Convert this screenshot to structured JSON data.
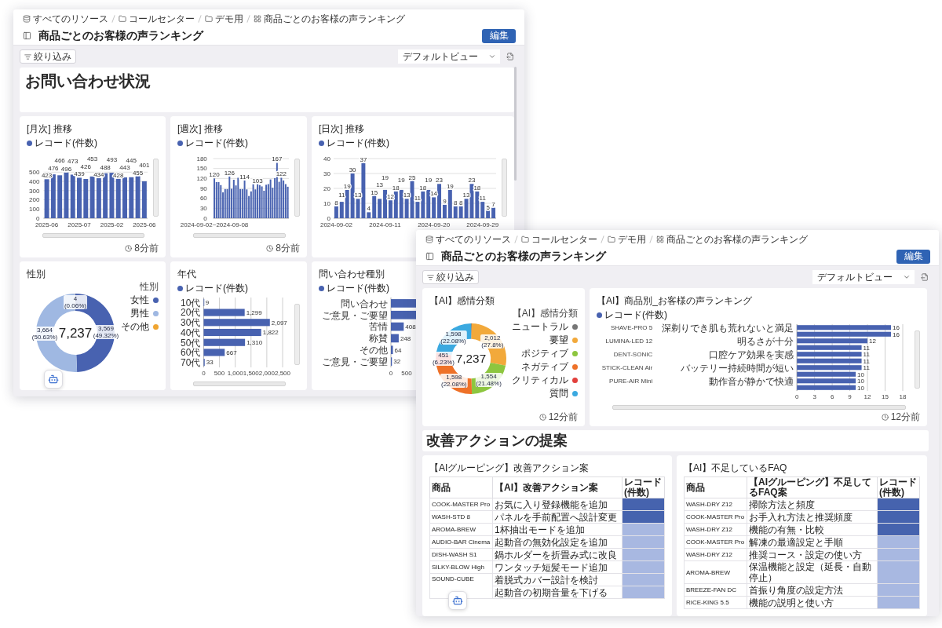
{
  "windows": [
    {
      "breadcrumb": [
        {
          "kind": "database",
          "label": "すべてのリソース"
        },
        {
          "kind": "folder",
          "label": "コールセンター"
        },
        {
          "kind": "folder",
          "label": "デモ用"
        },
        {
          "kind": "dashboard",
          "label": "商品ごとのお客様の声ランキング"
        }
      ],
      "title": "商品ごとのお客様の声ランキング",
      "edit_button": "編集",
      "filter_button": "絞り込み",
      "view_select": "デフォルトビュー",
      "scrollbar": true,
      "blocks": [
        {
          "kind": "heading",
          "text": "お問い合わせ状況"
        },
        {
          "kind": "cards",
          "cards": [
            {
              "kind": "chart",
              "title": "[月次] 推移",
              "vertical_scrollbar": true,
              "horizontal_scrollbar": true,
              "updated": "8分前",
              "chart_data": {
                "type": "bar",
                "categories": [
                  "2025-06",
                  null,
                  null,
                  null,
                  null,
                  "2025-07",
                  null,
                  null,
                  null,
                  null,
                  "2025-02",
                  null,
                  null,
                  null,
                  null,
                  "2025-06"
                ],
                "series": [
                  {
                    "name": "レコード(件数)",
                    "color": "#4862b0",
                    "values": [
                      423,
                      476,
                      466,
                      496,
                      473,
                      439,
                      426,
                      453,
                      434,
                      488,
                      493,
                      428,
                      443,
                      445,
                      455,
                      401
                    ]
                  }
                ],
                "ylim": [
                  0,
                  500
                ],
                "yticks": [
                  0,
                  100,
                  200,
                  300,
                  400,
                  500
                ],
                "grid": true,
                "data_labels": true
              }
            },
            {
              "kind": "chart",
              "title": "[週次] 推移",
              "vertical_scrollbar": true,
              "horizontal_scrollbar": true,
              "updated": "8分前",
              "chart_data": {
                "type": "bar",
                "categories": [
                  "2024-09-02~2024-09-08",
                  null,
                  null,
                  null,
                  null,
                  null,
                  null,
                  null,
                  null,
                  null,
                  null,
                  null,
                  null,
                  null,
                  null,
                  null,
                  null,
                  null,
                  null,
                  null,
                  null,
                  null,
                  null,
                  null,
                  null,
                  null,
                  null,
                  null,
                  null,
                  null,
                  null,
                  null,
                  null,
                  null,
                  null
                ],
                "series": [
                  {
                    "name": "レコード(件数)",
                    "color": "#4862b0",
                    "values": [
                      120,
                      109,
                      109,
                      100,
                      78,
                      88,
                      88,
                      126,
                      89,
                      116,
                      99,
                      122,
                      88,
                      88,
                      114,
                      87,
                      67,
                      81,
                      103,
                      87,
                      103,
                      100,
                      96,
                      83,
                      101,
                      103,
                      117,
                      92,
                      121,
                      167,
                      110,
                      122,
                      114,
                      103,
                      95
                    ]
                  }
                ],
                "value_labels": [
                  "120",
                  null,
                  null,
                  null,
                  null,
                  null,
                  null,
                  "126",
                  null,
                  null,
                  null,
                  null,
                  null,
                  null,
                  "114",
                  null,
                  null,
                  null,
                  null,
                  null,
                  "103",
                  null,
                  null,
                  null,
                  null,
                  null,
                  null,
                  null,
                  null,
                  "167",
                  null,
                  "122",
                  null,
                  null,
                  null
                ],
                "ylim": [
                  0,
                  180
                ],
                "yticks": [
                  0,
                  30,
                  60,
                  90,
                  120,
                  150,
                  180
                ],
                "grid": true
              }
            },
            {
              "kind": "chart",
              "title": "[日次] 推移",
              "vertical_scrollbar": true,
              "chart_data": {
                "type": "bar",
                "categories": [
                  "2024-09-02",
                  null,
                  null,
                  null,
                  null,
                  null,
                  null,
                  null,
                  null,
                  "2024-09-11",
                  null,
                  null,
                  null,
                  null,
                  null,
                  null,
                  null,
                  null,
                  "2024-09-20",
                  null,
                  null,
                  null,
                  null,
                  null,
                  null,
                  null,
                  null,
                  "2024-09-29",
                  null,
                  null
                ],
                "series": [
                  {
                    "name": "レコード(件数)",
                    "color": "#4862b0",
                    "values": [
                      8,
                      11,
                      19,
                      30,
                      13,
                      37,
                      4,
                      15,
                      13,
                      19,
                      12,
                      18,
                      19,
                      13,
                      25,
                      11,
                      18,
                      19,
                      14,
                      23,
                      9,
                      19,
                      8,
                      8,
                      13,
                      23,
                      18,
                      11,
                      5,
                      7
                    ]
                  }
                ],
                "ylim": [
                  0,
                  40
                ],
                "yticks": [
                  0,
                  10,
                  20,
                  30,
                  40
                ],
                "grid": true,
                "data_labels": true
              }
            }
          ]
        },
        {
          "kind": "cards",
          "cards": [
            {
              "kind": "chart",
              "title": "性別",
              "legend_title": "性別",
              "total": "7,237",
              "chart_data": {
                "type": "donut",
                "categories": [
                  "女性",
                  "男性",
                  "その他"
                ],
                "values": [
                  3569,
                  3664,
                  4
                ],
                "colors": [
                  "#4862b0",
                  "#9fb8e2",
                  "#f0a531"
                ],
                "value_labels": [
                  "3,569\n(49.32%)",
                  "3,664\n(50.63%)",
                  "4\n(0.06%)"
                ]
              }
            },
            {
              "kind": "chart",
              "title": "年代",
              "vertical_scrollbar": true,
              "horizontal_scrollbar": true,
              "chart_data": {
                "type": "bar",
                "orientation": "horizontal",
                "categories": [
                  "10代",
                  "20代",
                  "30代",
                  "40代",
                  "50代",
                  "60代",
                  "70代"
                ],
                "series": [
                  {
                    "name": "レコード(件数)",
                    "color": "#4862b0",
                    "values": [
                      9,
                      1299,
                      2097,
                      1822,
                      1310,
                      667,
                      33
                    ]
                  }
                ],
                "value_labels": [
                  "9",
                  "1,299",
                  "2,097",
                  "1,822",
                  "1,310",
                  "667",
                  "33"
                ],
                "xlim": [
                  0,
                  2500
                ],
                "xticks": [
                  {
                    "value": 0,
                    "label": "0"
                  },
                  {
                    "value": 500,
                    "label": "500"
                  },
                  {
                    "value": 1000,
                    "label": "1,000"
                  },
                  {
                    "value": 1500,
                    "label": "1,500"
                  },
                  {
                    "value": 2000,
                    "label": "2,000"
                  },
                  {
                    "value": 2500,
                    "label": "2,500"
                  }
                ],
                "grid": true
              }
            },
            {
              "kind": "chart",
              "title": "問い合わせ種別",
              "chart_data": {
                "type": "bar",
                "orientation": "horizontal",
                "categories": [
                  "問い合わせ",
                  "ご意見・ご要望",
                  "苦情",
                  "称賛",
                  "その他",
                  "ご意見・ご要望"
                ],
                "series": [
                  {
                    "name": "レコード(件数)",
                    "color": "#4862b0",
                    "values": [
                      null,
                      null,
                      408,
                      248,
                      64,
                      32
                    ]
                  }
                ],
                "xlim": [
                  0,
                  500
                ],
                "xticks": [
                  0,
                  500
                ],
                "data_labels": true
              }
            }
          ]
        }
      ]
    },
    {
      "breadcrumb": [
        {
          "kind": "database",
          "label": "すべてのリソース"
        },
        {
          "kind": "folder",
          "label": "コールセンター"
        },
        {
          "kind": "folder",
          "label": "デモ用"
        },
        {
          "kind": "dashboard",
          "label": "商品ごとのお客様の声ランキング"
        }
      ],
      "title": "商品ごとのお客様の声ランキング",
      "edit_button": "編集",
      "filter_button": "絞り込み",
      "view_select": "デフォルトビュー",
      "blocks": [
        {
          "kind": "cards",
          "cards": [
            {
              "kind": "chart",
              "title": "【AI】感情分類",
              "legend_title": "【AI】感情分類",
              "total": "7,237",
              "updated": "12分前",
              "chart_data": {
                "type": "donut",
                "categories": [
                  "ニュートラル",
                  "要望",
                  "ポジティブ",
                  "ネガティブ",
                  "クリティカル",
                  "質問"
                ],
                "values": [
                  24,
                  2012,
                  1554,
                  1598,
                  451,
                  1598
                ],
                "colors": [
                  "#767676",
                  "#f2a93b",
                  "#8dc63f",
                  "#ee7128",
                  "#e2403c",
                  "#3ba9e0"
                ],
                "value_labels": [
                  null,
                  "2,012\n(27.8%)",
                  "1,554\n(21.48%)",
                  "1,598\n(22.08%)",
                  "451\n(6.23%)",
                  "1,598\n(22.08%)"
                ]
              }
            },
            {
              "kind": "chart",
              "title": "【AI】商品別_お客様の声ランキング",
              "vertical_scrollbar": true,
              "horizontal_scrollbar": true,
              "updated": "12分前",
              "chart_data": {
                "type": "bar",
                "orientation": "horizontal",
                "categories": [
                  "深剃りでき肌も荒れないと満足",
                  null,
                  "明るさが十分",
                  null,
                  "口腔ケア効果を実感",
                  null,
                  "バッテリー持続時間が短い",
                  null,
                  "動作音が静かで快適",
                  null
                ],
                "series": [
                  {
                    "name": "レコード(件数)",
                    "color": "#4862b0",
                    "values": [
                      16,
                      16,
                      12,
                      11,
                      11,
                      11,
                      11,
                      10,
                      10,
                      10
                    ]
                  }
                ],
                "annotations": [
                  "SHAVE-PRO 5",
                  "LUMINA-LED 12",
                  "DENT-SONIC",
                  "STICK-CLEAN Air",
                  "PURE-AIR Mini"
                ],
                "xlim": [
                  0,
                  18
                ],
                "xticks": [
                  0,
                  3,
                  6,
                  9,
                  12,
                  15,
                  18
                ],
                "grid": true,
                "data_labels": true
              }
            }
          ]
        },
        {
          "kind": "heading",
          "text": "改善アクションの提案"
        },
        {
          "kind": "cards",
          "cards": [
            {
              "kind": "table",
              "title": "【AIグルーピング】改善アクション案",
              "columns": [
                "商品",
                "【AI】改善アクション案",
                "レコード(件数)"
              ],
              "rows": [
                {
                  "product": "COOK-MASTER Pro",
                  "text": "お気に入り登録機能を追加",
                  "color": "#4663ae"
                },
                {
                  "product": "WASH-STD 8",
                  "text": "パネルを手前配置へ設計変更",
                  "color": "#4663ae"
                },
                {
                  "product": "AROMA-BREW",
                  "text": "1杯抽出モードを追加",
                  "color": "#a8b8e1"
                },
                {
                  "product": "AUDIO-BAR Cinema",
                  "text": "起動音の無効化設定を追加",
                  "color": "#a8b8e1"
                },
                {
                  "product": "DISH-WASH S1",
                  "text": "鍋ホルダーを折畳み式に改良",
                  "color": "#a8b8e1"
                },
                {
                  "product": "SILKY-BLOW High",
                  "text": "ワンタッチ短髪モード追加",
                  "color": "#a8b8e1"
                },
                {
                  "product": "SOUND-CUBE",
                  "text": "着脱式カバー設計を検討",
                  "color": "#a8b8e1"
                },
                {
                  "text": "起動音の初期音量を下げる",
                  "color": "#a8b8e1"
                }
              ]
            },
            {
              "kind": "table",
              "title": "【AI】不足しているFAQ",
              "columns": [
                "商品",
                "【AIグルーピング】不足してるFAQ案",
                "レコード(件数)"
              ],
              "rows": [
                {
                  "product": "WASH-DRY Z12",
                  "text": "掃除方法と頻度",
                  "color": "#4663ae"
                },
                {
                  "product": "COOK-MASTER Pro",
                  "text": "お手入れ方法と推奨頻度",
                  "color": "#4663ae"
                },
                {
                  "product": "WASH-DRY Z12",
                  "text": "機能の有無・比較",
                  "color": "#4663ae"
                },
                {
                  "product": "COOK-MASTER Pro",
                  "text": "解凍の最適設定と手順",
                  "color": "#a8b8e1"
                },
                {
                  "product": "WASH-DRY Z12",
                  "text": "推奨コース・設定の使い方",
                  "color": "#a8b8e1"
                },
                {
                  "product": "AROMA-BREW",
                  "text": "保温機能と設定（延長・自動停止）",
                  "color": "#a8b8e1"
                },
                {
                  "product": "BREEZE-FAN DC",
                  "text": "首振り角度の設定方法",
                  "color": "#a8b8e1"
                },
                {
                  "product": "RICE-KING 5.5",
                  "text": "機能の説明と使い方",
                  "color": "#a8b8e1"
                }
              ]
            }
          ]
        }
      ]
    }
  ]
}
